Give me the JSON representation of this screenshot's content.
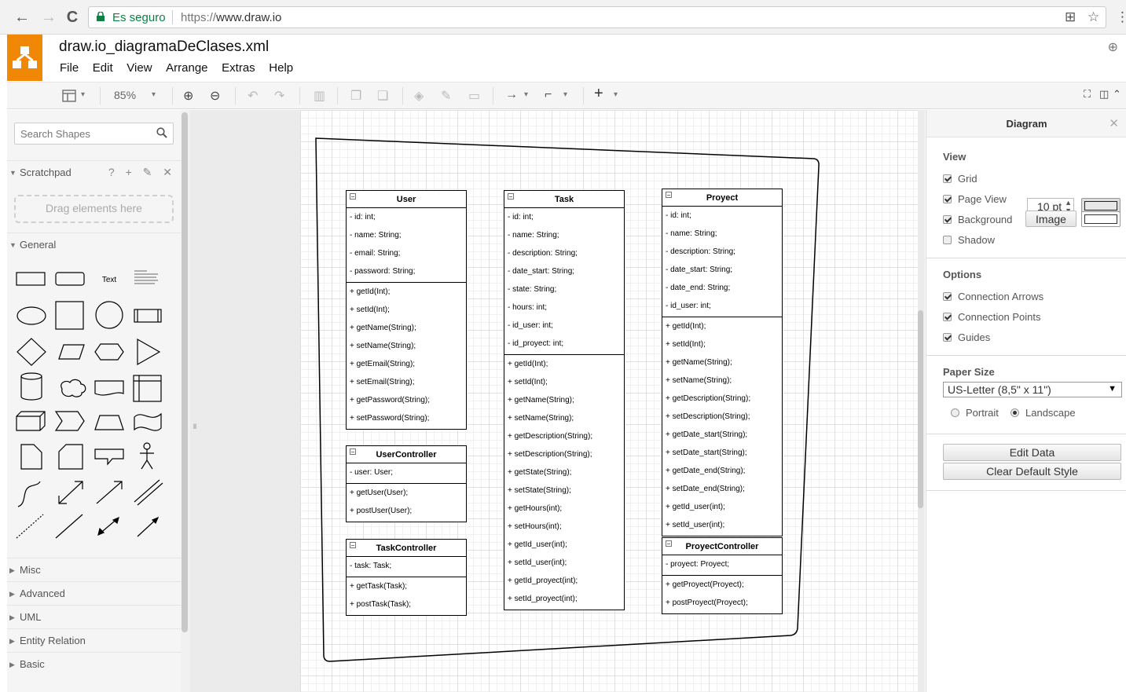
{
  "browser": {
    "secure_label": "Es seguro",
    "url_scheme": "https://",
    "url_host": "www.draw.io",
    "back_icon": "←",
    "forward_icon": "→",
    "reload_icon": "C"
  },
  "app": {
    "title": "draw.io_diagramaDeClases.xml",
    "menu": [
      "File",
      "Edit",
      "View",
      "Arrange",
      "Extras",
      "Help"
    ],
    "zoom": "85%"
  },
  "sidebar": {
    "search_placeholder": "Search Shapes",
    "scratchpad": "Scratchpad",
    "scratchpad_icons": "? + ✎ ✕",
    "drop_hint": "Drag elements here",
    "general": "General",
    "text_shape": "Text",
    "sections": [
      "Misc",
      "Advanced",
      "UML",
      "Entity Relation",
      "Basic"
    ]
  },
  "classes": {
    "user": {
      "name": "User",
      "attrs": [
        "- id: int;",
        "- name: String;",
        "- email: String;",
        "- password: String;"
      ],
      "methods": [
        "+ getId(Int);",
        "+ setId(Int);",
        "+ getName(String);",
        "+ setName(String);",
        "+ getEmail(String);",
        "+ setEmail(String);",
        "+ getPassword(String);",
        "+ setPassword(String);"
      ]
    },
    "usercontroller": {
      "name": "UserController",
      "attrs": [
        "- user: User;"
      ],
      "methods": [
        "+ getUser(User);",
        "+ postUser(User);"
      ]
    },
    "taskcontroller": {
      "name": "TaskController",
      "attrs": [
        "- task: Task;"
      ],
      "methods": [
        "+ getTask(Task);",
        "+ postTask(Task);"
      ]
    },
    "task": {
      "name": "Task",
      "attrs": [
        "- id: int;",
        "- name: String;",
        "- description: String;",
        "- date_start: String;",
        "- state: String;",
        "- hours: int;",
        "- id_user: int;",
        "- id_proyect: int;"
      ],
      "methods": [
        "+ getId(Int);",
        "+ setId(Int);",
        "+ getName(String);",
        "+ setName(String);",
        "+ getDescription(String);",
        "+ setDescription(String);",
        "+ getState(String);",
        "+ setState(String);",
        "+ getHours(int);",
        "+ setHours(int);",
        "+ getId_user(int);",
        "+ setId_user(int);",
        "+ getId_proyect(int);",
        "+ setId_proyect(int);"
      ]
    },
    "proyect": {
      "name": "Proyect",
      "attrs": [
        "- id: int;",
        "- name: String;",
        "- description: String;",
        "- date_start: String;",
        "- date_end: String;",
        "- id_user: int;"
      ],
      "methods": [
        "+ getId(Int);",
        "+ setId(Int);",
        "+ getName(String);",
        "+ setName(String);",
        "+ getDescription(String);",
        "+ setDescription(String);",
        "+ getDate_start(String);",
        "+ setDate_start(String);",
        "+ getDate_end(String);",
        "+ setDate_end(String);",
        "+ getId_user(int);",
        "+ setId_user(int);"
      ]
    },
    "proyectcontroller": {
      "name": "ProyectController",
      "attrs": [
        "- proyect: Proyect;"
      ],
      "methods": [
        "+ getProyect(Proyect);",
        "+ postProyect(Proyect);"
      ]
    }
  },
  "panel": {
    "tab": "Diagram",
    "close": "✕",
    "view_heading": "View",
    "grid_label": "Grid",
    "grid_checked": true,
    "grid_size": "10 pt",
    "page_view_label": "Page View",
    "page_view_checked": true,
    "background_label": "Background",
    "background_checked": true,
    "image_button": "Image",
    "shadow_label": "Shadow",
    "shadow_checked": false,
    "options_heading": "Options",
    "connection_arrows": "Connection Arrows",
    "connection_points": "Connection Points",
    "guides": "Guides",
    "paper_heading": "Paper Size",
    "paper_value": "US-Letter (8,5\" x 11\")",
    "portrait": "Portrait",
    "landscape": "Landscape",
    "orientation": "landscape",
    "edit_data": "Edit Data",
    "clear_style": "Clear Default Style"
  },
  "colors": {
    "brand": "#f08705",
    "secure": "#0b8043"
  }
}
